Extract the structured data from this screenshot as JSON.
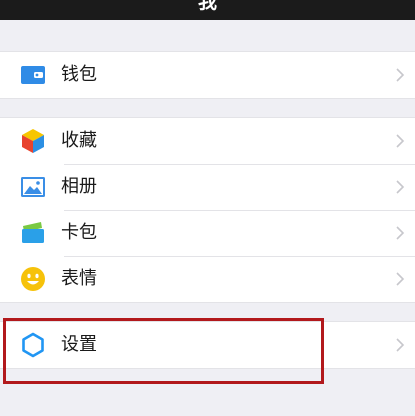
{
  "header": {
    "title": "我"
  },
  "groups": [
    {
      "items": [
        {
          "label": "钱包",
          "icon": "wallet-icon"
        }
      ]
    },
    {
      "items": [
        {
          "label": "收藏",
          "icon": "favorites-cube-icon"
        },
        {
          "label": "相册",
          "icon": "album-photo-icon"
        },
        {
          "label": "卡包",
          "icon": "card-wallet-icon"
        },
        {
          "label": "表情",
          "icon": "sticker-smiley-icon"
        }
      ]
    },
    {
      "items": [
        {
          "label": "设置",
          "icon": "settings-gear-icon"
        }
      ]
    }
  ],
  "colors": {
    "wallet": "#2f8be6",
    "album": "#3a8ee6",
    "card": "#2aa0e8",
    "smiley": "#f6c20a",
    "settings": "#2196f3",
    "highlight_border": "#b2191c"
  }
}
